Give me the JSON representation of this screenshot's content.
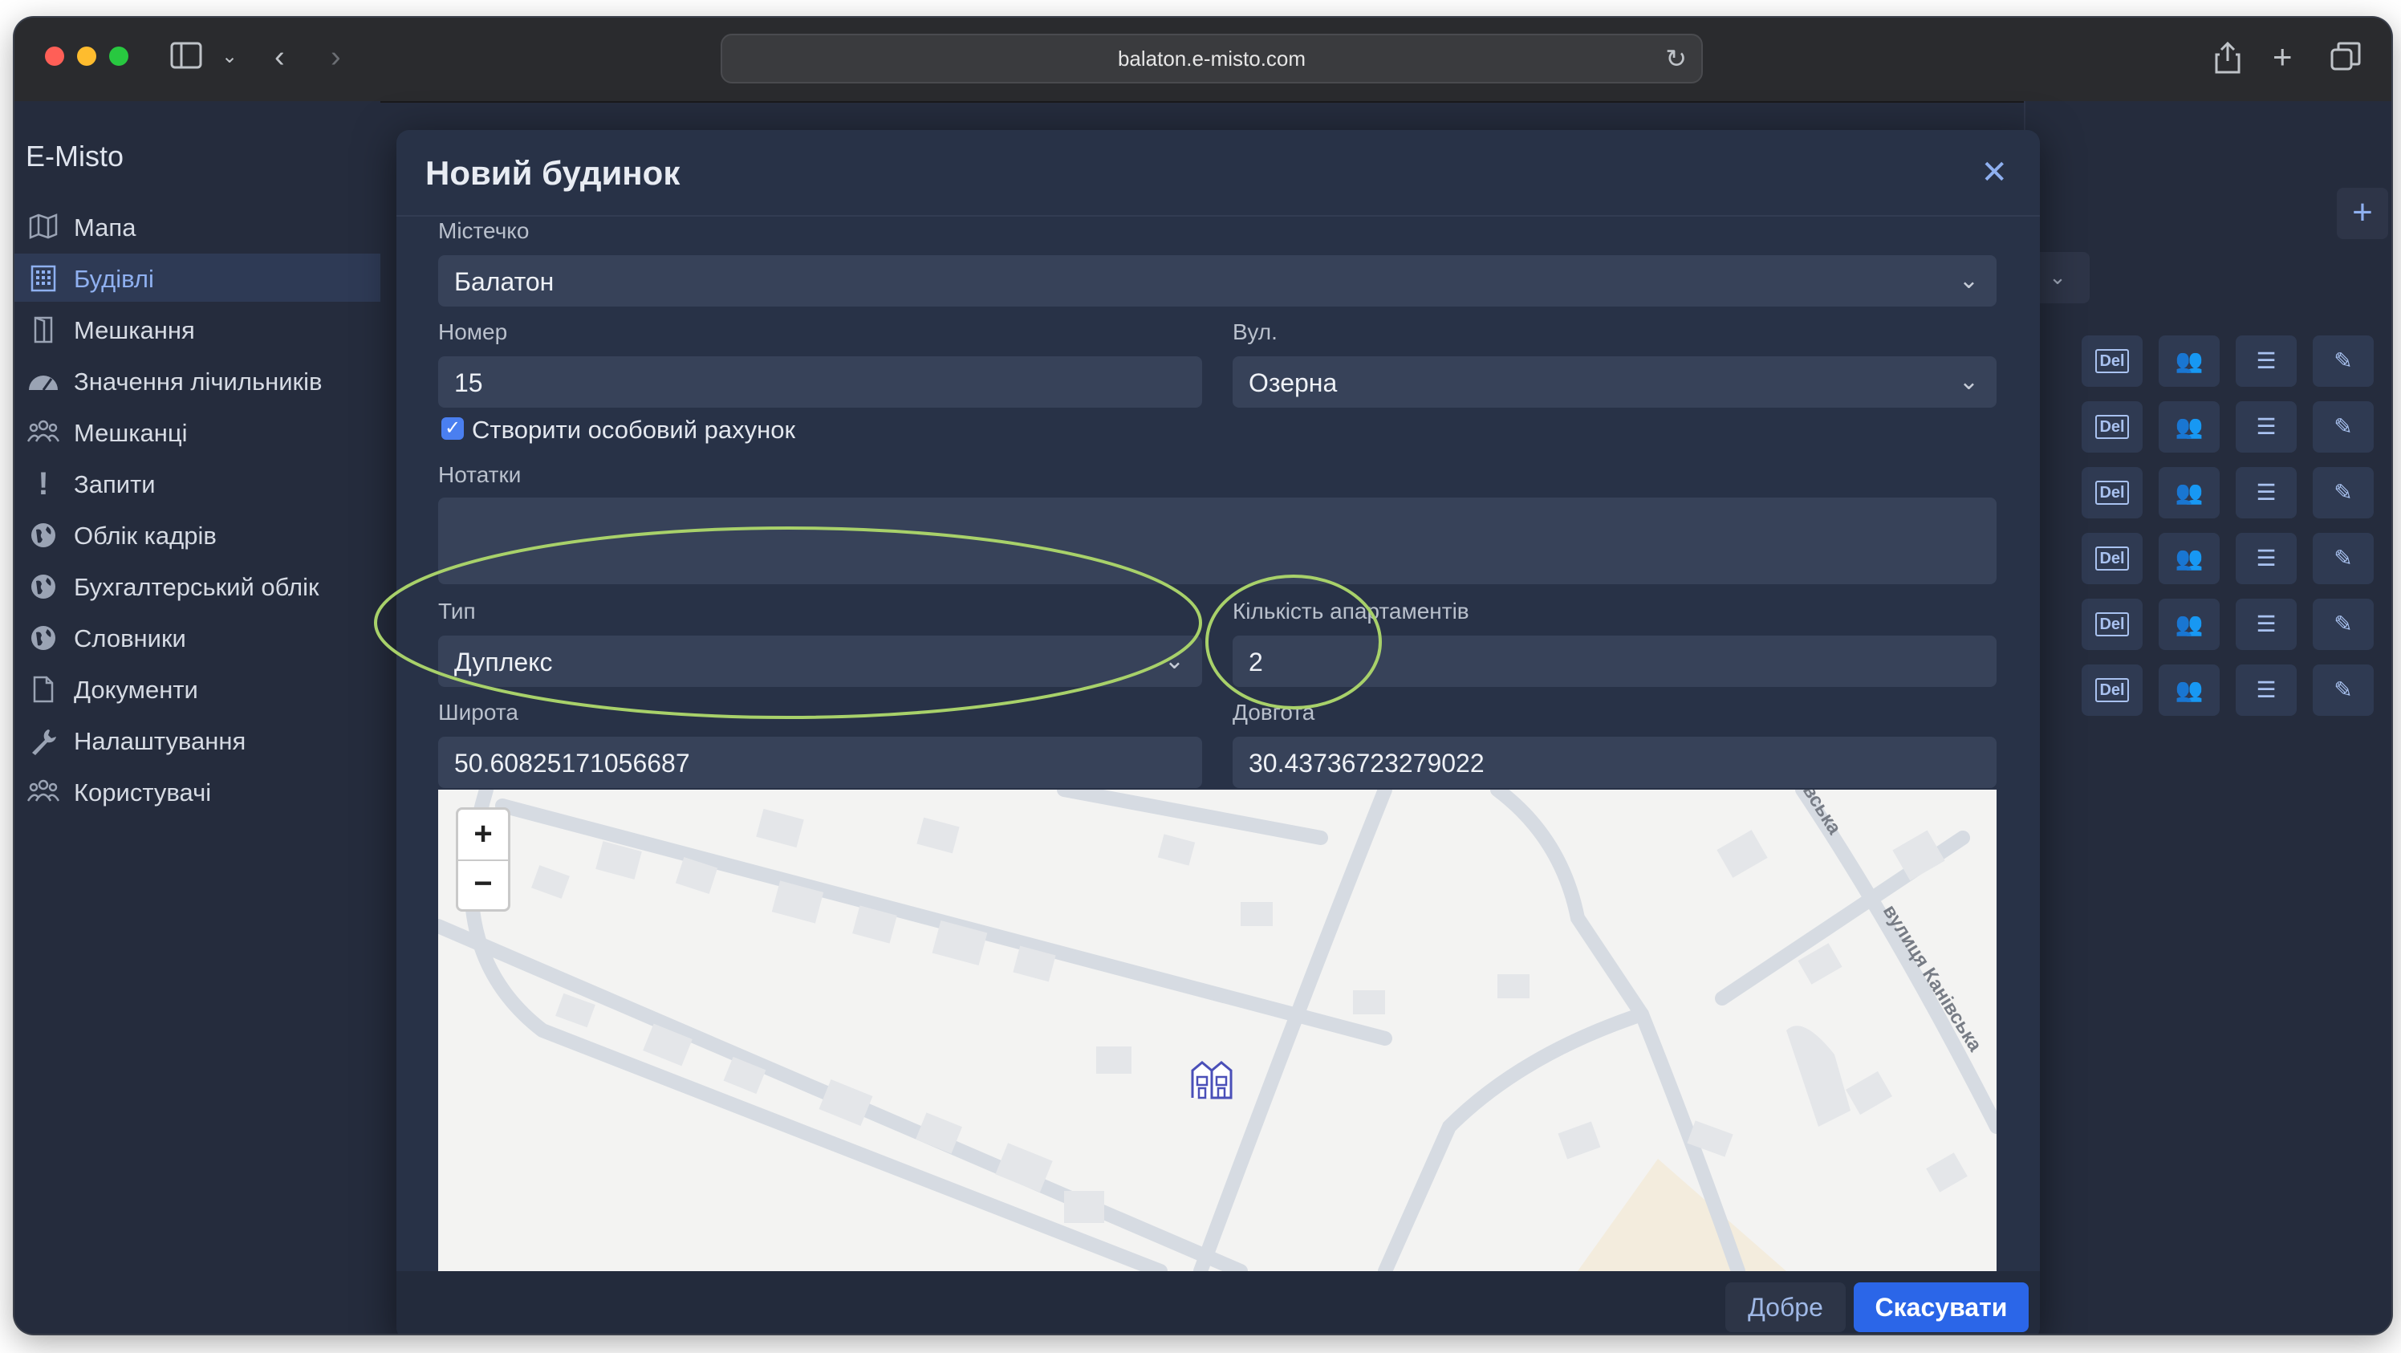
{
  "browser": {
    "url": "balaton.e-misto.com"
  },
  "sidebar": {
    "brand": "E-Misto",
    "items": [
      {
        "label": "Мапа",
        "icon": "map-icon",
        "active": false
      },
      {
        "label": "Будівлі",
        "icon": "building-icon",
        "active": true
      },
      {
        "label": "Мешкання",
        "icon": "door-icon",
        "active": false
      },
      {
        "label": "Значення лічильників",
        "icon": "gauge-icon",
        "active": false
      },
      {
        "label": "Мешканці",
        "icon": "people-icon",
        "active": false
      },
      {
        "label": "Запити",
        "icon": "exclamation-icon",
        "active": false
      },
      {
        "label": "Облік кадрів",
        "icon": "globe-icon",
        "active": false
      },
      {
        "label": "Бухгалтерський облік",
        "icon": "globe-icon",
        "active": false
      },
      {
        "label": "Словники",
        "icon": "globe-icon",
        "active": false
      },
      {
        "label": "Документи",
        "icon": "document-icon",
        "active": false
      },
      {
        "label": "Налаштування",
        "icon": "wrench-icon",
        "active": false
      },
      {
        "label": "Користувачі",
        "icon": "users-icon",
        "active": false
      }
    ]
  },
  "modal": {
    "title": "Новий будинок",
    "town": {
      "label": "Містечко",
      "value": "Балатон"
    },
    "number": {
      "label": "Номер",
      "value": "15"
    },
    "street": {
      "label": "Вул.",
      "value": "Озерна"
    },
    "special_account": {
      "label": "Створити особовий рахунок",
      "checked": true
    },
    "notes": {
      "label": "Нотатки",
      "value": ""
    },
    "type": {
      "label": "Тип",
      "value": "Дуплекс"
    },
    "apartments": {
      "label": "Кількість апартаментів",
      "value": "2"
    },
    "latitude": {
      "label": "Широта",
      "value": "50.60825171056687"
    },
    "longitude": {
      "label": "Довгота",
      "value": "30.43736723279022"
    },
    "map": {
      "street_label_1": "вулиця Канівська",
      "street_label_2": "вська",
      "zoom_in": "+",
      "zoom_out": "−"
    },
    "ok_label": "Добре",
    "cancel_label": "Скасувати"
  },
  "right_pane": {
    "add_label": "+",
    "del_label": "Del",
    "rows": 6
  },
  "annotation_color": "#a8d16a"
}
